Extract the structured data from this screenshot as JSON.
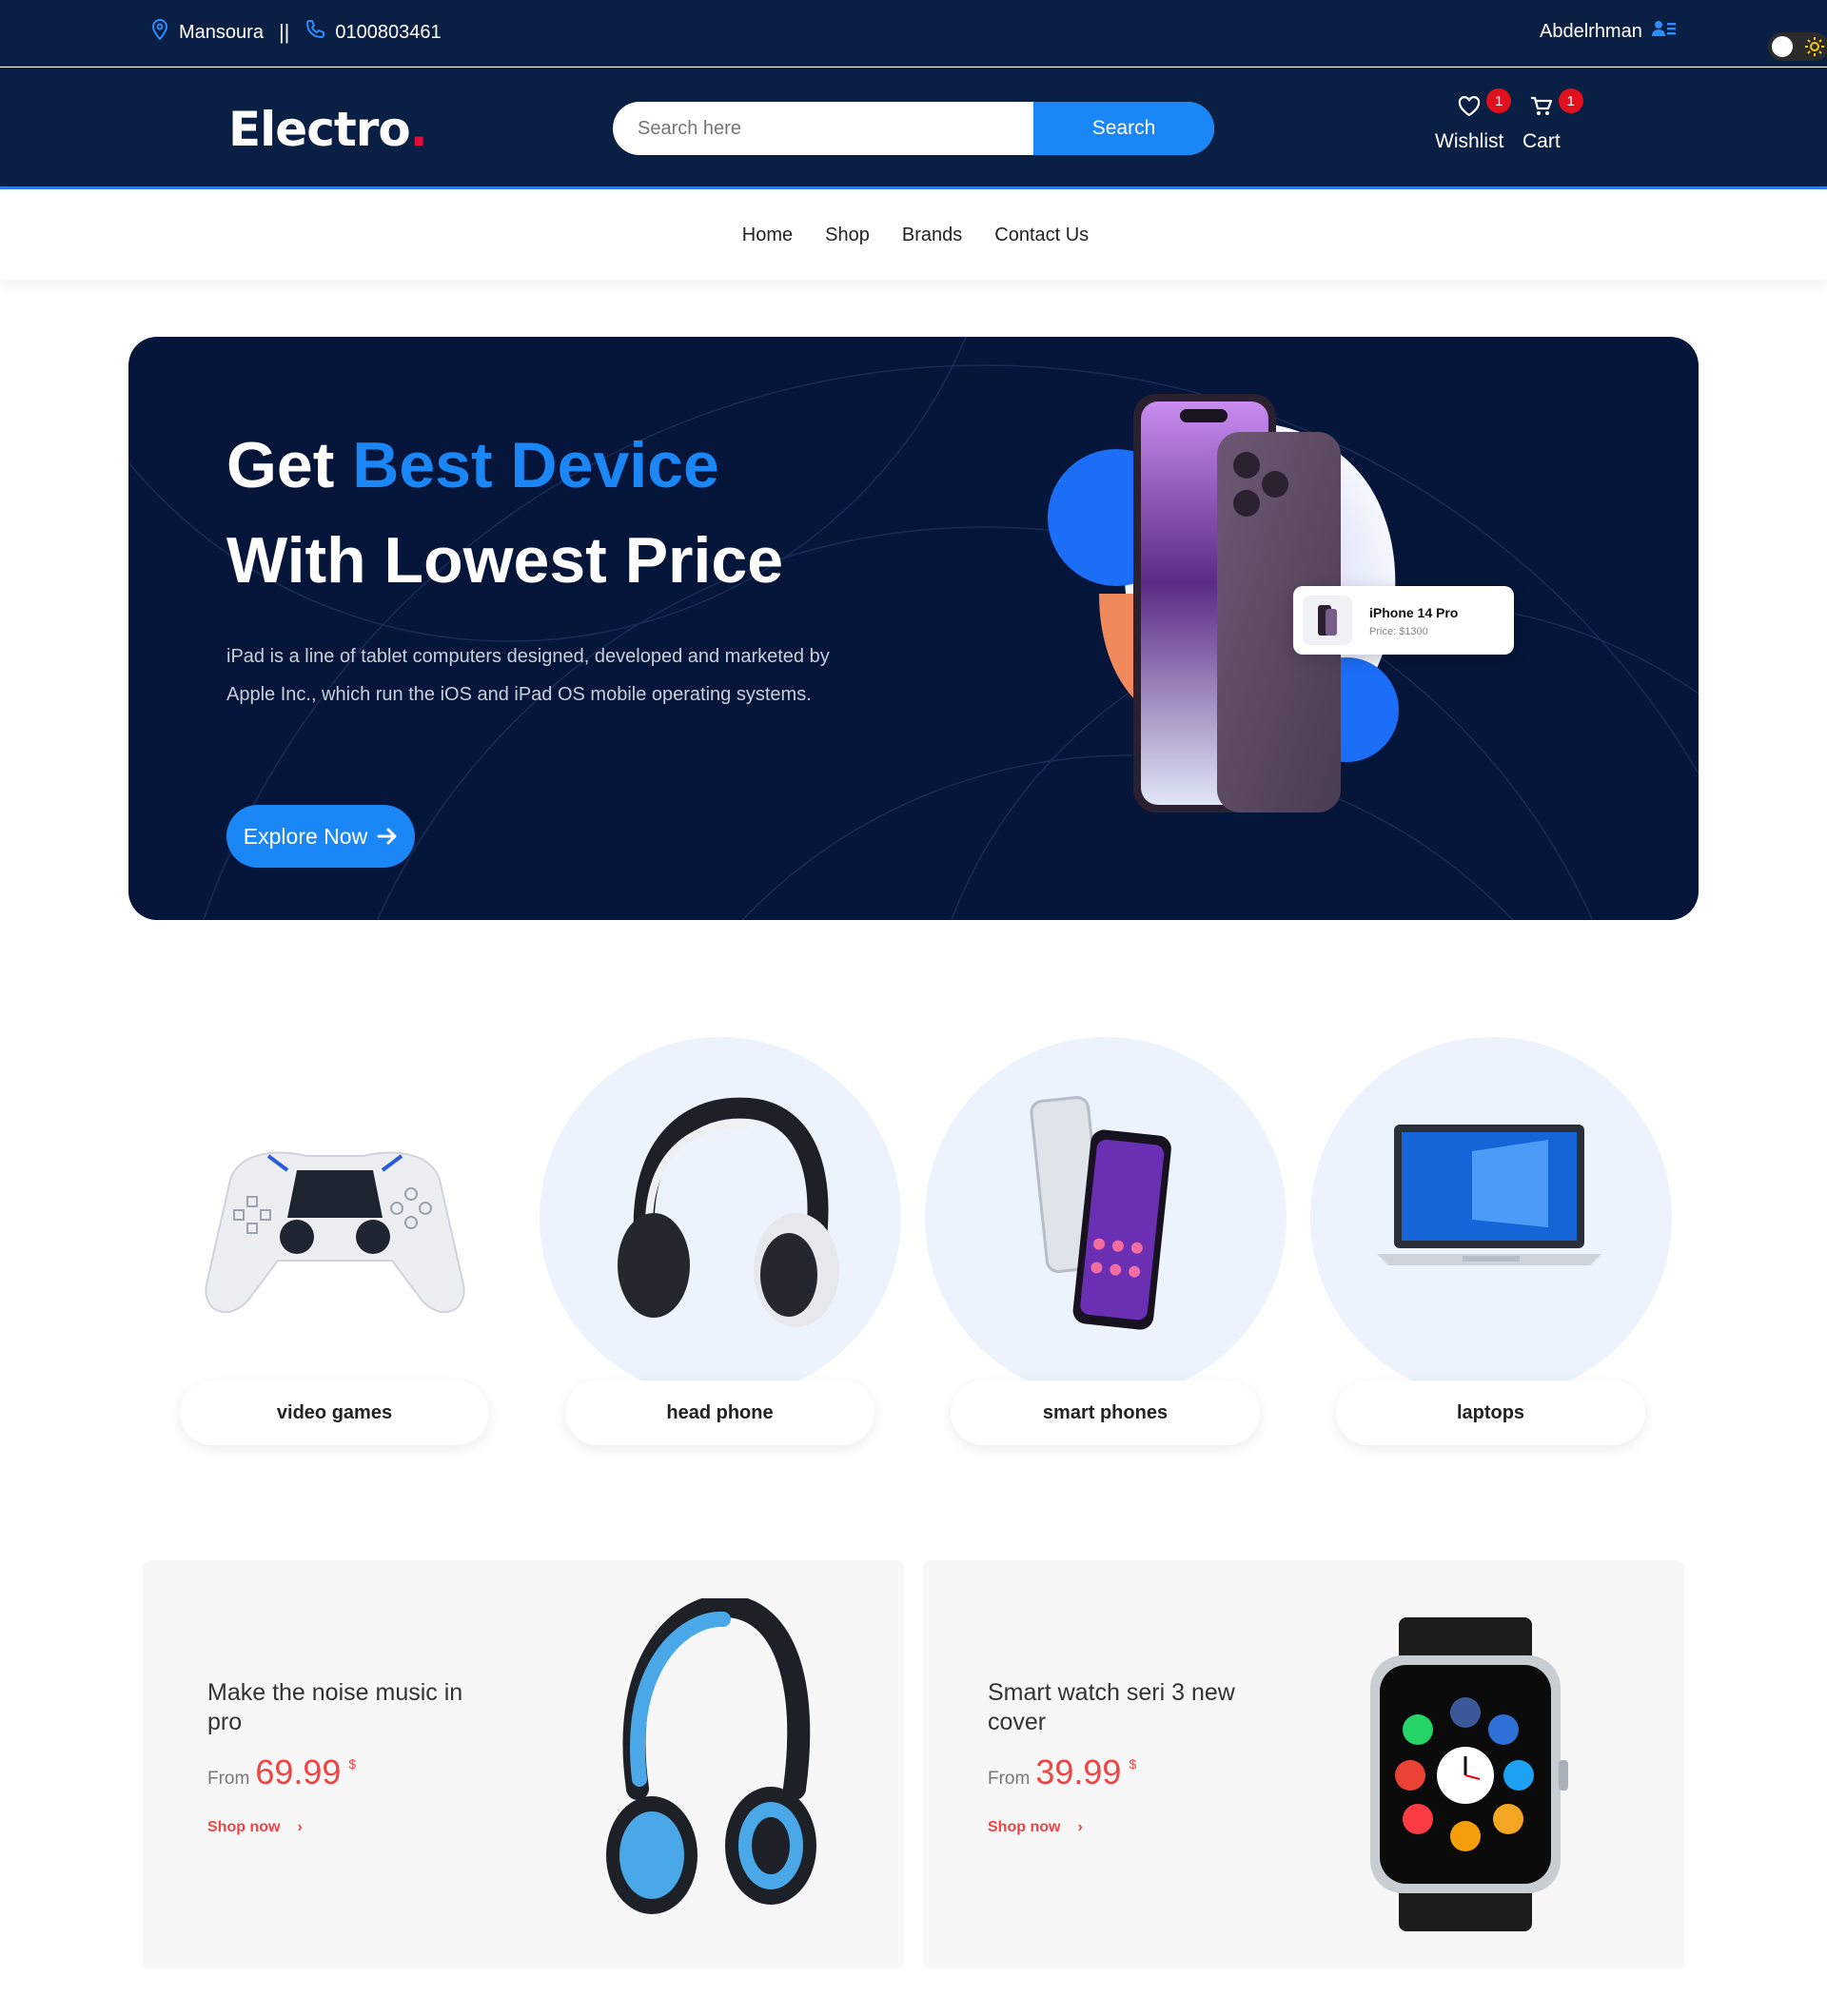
{
  "topbar": {
    "location": "Mansoura",
    "separator": "||",
    "phone": "0100803461",
    "username": "Abdelrhman"
  },
  "header": {
    "logo_text": "Electro",
    "logo_dot": ".",
    "search_placeholder": "Search here",
    "search_button": "Search",
    "wishlist_label": "Wishlist",
    "wishlist_count": "1",
    "cart_label": "Cart",
    "cart_count": "1"
  },
  "nav": {
    "items": [
      {
        "label": "Home"
      },
      {
        "label": "Shop"
      },
      {
        "label": "Brands"
      },
      {
        "label": "Contact Us"
      }
    ]
  },
  "hero": {
    "title_part1": "Get ",
    "title_highlight": "Best Device",
    "title_line2": "With Lowest Price",
    "description": "iPad is a line of tablet computers designed, developed and marketed by Apple Inc., which run the iOS and iPad OS mobile operating systems.",
    "cta_label": "Explore Now",
    "product_name": "iPhone 14 Pro",
    "product_price": "Price: $1300"
  },
  "categories": [
    {
      "label": "video games"
    },
    {
      "label": "head phone"
    },
    {
      "label": "smart phones"
    },
    {
      "label": "laptops"
    }
  ],
  "promos": [
    {
      "title": "Make the noise music in pro",
      "from_label": "From",
      "price": "69.99",
      "currency": "$",
      "shop_label": "Shop now",
      "chevron": "›"
    },
    {
      "title": "Smart watch seri 3 new cover",
      "from_label": "From",
      "price": "39.99",
      "currency": "$",
      "shop_label": "Shop now",
      "chevron": "›"
    }
  ],
  "colors": {
    "navy": "#0a1f44",
    "hero_bg": "#05163a",
    "accent_blue": "#1b86f5",
    "badge_red": "#e0101e",
    "price_red": "#ef4444",
    "category_circle": "#edf3fd"
  }
}
